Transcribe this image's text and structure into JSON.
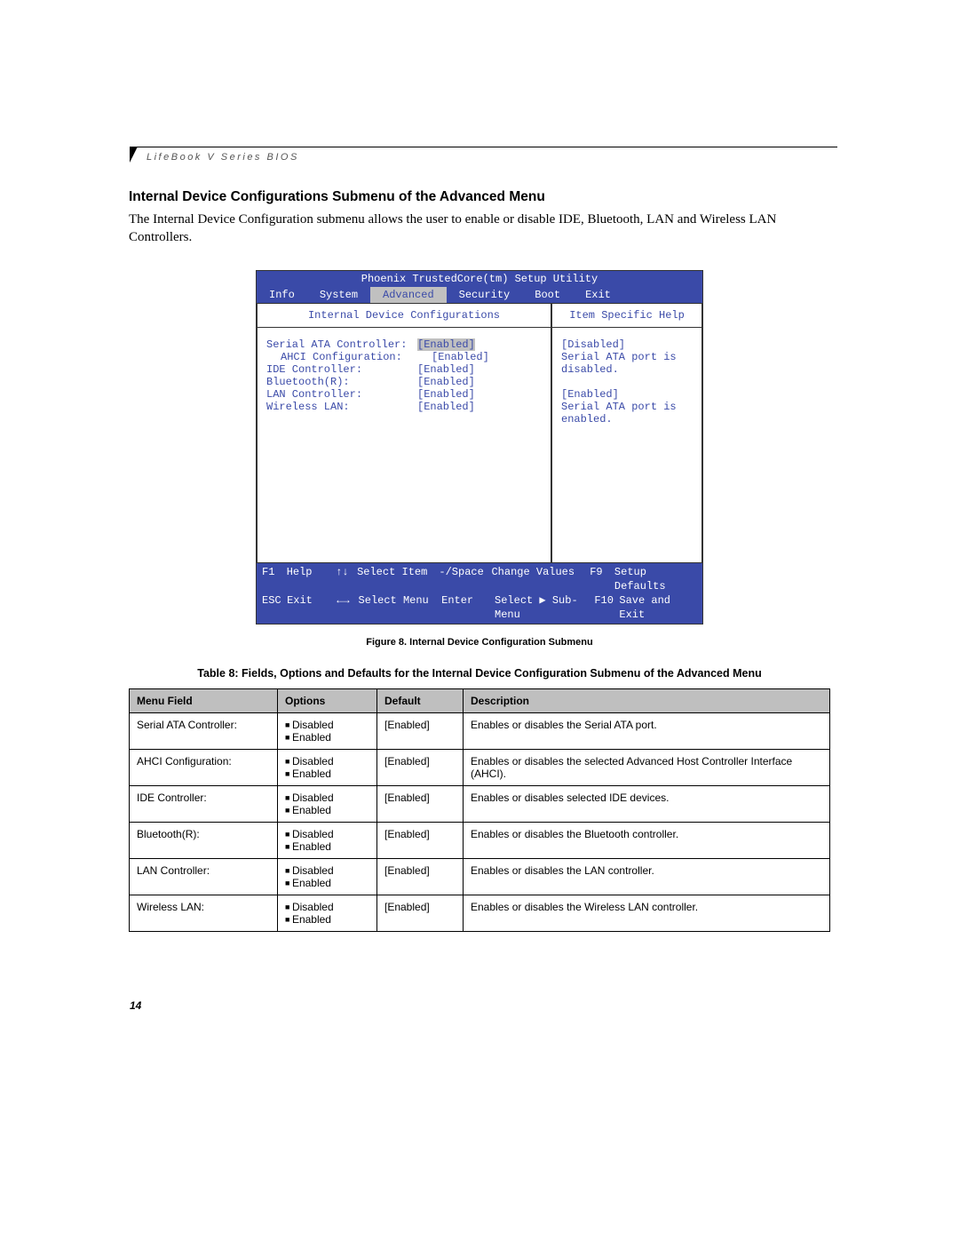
{
  "running_head": "LifeBook V Series BIOS",
  "section_title": "Internal Device Configurations Submenu of the Advanced Menu",
  "intro_paragraph": "The Internal Device Configuration submenu allows the user to enable or disable IDE, Bluetooth, LAN and Wireless LAN Controllers.",
  "bios": {
    "utility_title": "Phoenix TrustedCore(tm) Setup Utility",
    "tabs": [
      "Info",
      "System",
      "Advanced",
      "Security",
      "Boot",
      "Exit"
    ],
    "active_tab_index": 2,
    "left_title": "Internal Device Configurations",
    "right_title": "Item Specific Help",
    "settings": [
      {
        "label": "Serial ATA Controller:",
        "value": "[Enabled]",
        "highlight": true,
        "indent": false
      },
      {
        "label": "AHCI Configuration:",
        "value": "[Enabled]",
        "highlight": false,
        "indent": true
      },
      {
        "label": "IDE Controller:",
        "value": "[Enabled]",
        "highlight": false,
        "indent": false
      },
      {
        "label": "Bluetooth(R):",
        "value": "[Enabled]",
        "highlight": false,
        "indent": false
      },
      {
        "label": "LAN Controller:",
        "value": "[Enabled]",
        "highlight": false,
        "indent": false
      },
      {
        "label": "Wireless LAN:",
        "value": "[Enabled]",
        "highlight": false,
        "indent": false
      }
    ],
    "help_lines": [
      "[Disabled]",
      "Serial ATA port is",
      "disabled.",
      "",
      "[Enabled]",
      "Serial ATA port is",
      "enabled."
    ],
    "footer": {
      "f1": "F1",
      "f1_label": "Help",
      "ud": "↑↓",
      "ud_label": "Select Item",
      "pm": "-/Space",
      "pm_label": "Change Values",
      "f9": "F9",
      "f9_label": "Setup Defaults",
      "esc": "ESC",
      "esc_label": "Exit",
      "lr": "←→",
      "lr_label": "Select Menu",
      "enter": "Enter",
      "enter_label": "Select ▶ Sub-Menu",
      "f10": "F10",
      "f10_label": "Save and Exit"
    }
  },
  "figure_caption": "Figure 8.  Internal Device Configuration Submenu",
  "table_caption": "Table 8: Fields, Options and Defaults for the Internal Device Configuration Submenu of the Advanced Menu",
  "table": {
    "headers": [
      "Menu Field",
      "Options",
      "Default",
      "Description"
    ],
    "rows": [
      {
        "field": "Serial ATA Controller:",
        "indent": false,
        "options": [
          "Disabled",
          "Enabled"
        ],
        "default": "[Enabled]",
        "desc": "Enables or disables the Serial ATA port."
      },
      {
        "field": "AHCI Configuration:",
        "indent": true,
        "options": [
          "Disabled",
          "Enabled"
        ],
        "default": "[Enabled]",
        "desc": "Enables or disables the selected Advanced Host Controller Interface (AHCI)."
      },
      {
        "field": "IDE Controller:",
        "indent": false,
        "options": [
          "Disabled",
          "Enabled"
        ],
        "default": "[Enabled]",
        "desc": "Enables or disables selected IDE devices."
      },
      {
        "field": "Bluetooth(R):",
        "indent": false,
        "options": [
          "Disabled",
          "Enabled"
        ],
        "default": "[Enabled]",
        "desc": "Enables or disables the Bluetooth controller."
      },
      {
        "field": "LAN Controller:",
        "indent": false,
        "options": [
          "Disabled",
          "Enabled"
        ],
        "default": "[Enabled]",
        "desc": "Enables or disables the LAN controller."
      },
      {
        "field": "Wireless LAN:",
        "indent": false,
        "options": [
          "Disabled",
          "Enabled"
        ],
        "default": "[Enabled]",
        "desc": "Enables or disables the Wireless LAN controller."
      }
    ]
  },
  "page_number": "14"
}
